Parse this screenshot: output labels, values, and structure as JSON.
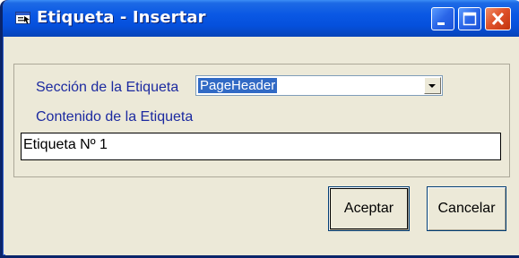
{
  "window": {
    "title": "Etiqueta - Insertar",
    "icons": {
      "app": "form-icon",
      "minimize": "minimize-icon",
      "maximize": "maximize-icon",
      "close": "close-icon"
    }
  },
  "form": {
    "section_label": "Sección de la Etiqueta",
    "section_value": "PageHeader",
    "content_label": "Contenido de la Etiqueta",
    "content_value": "Etiqueta Nº 1"
  },
  "buttons": {
    "accept": "Aceptar",
    "cancel": "Cancelar"
  },
  "colors": {
    "titlebar": "#0a58e4",
    "label": "#1c2aa0",
    "selection": "#316ac5",
    "close": "#e0532a"
  }
}
